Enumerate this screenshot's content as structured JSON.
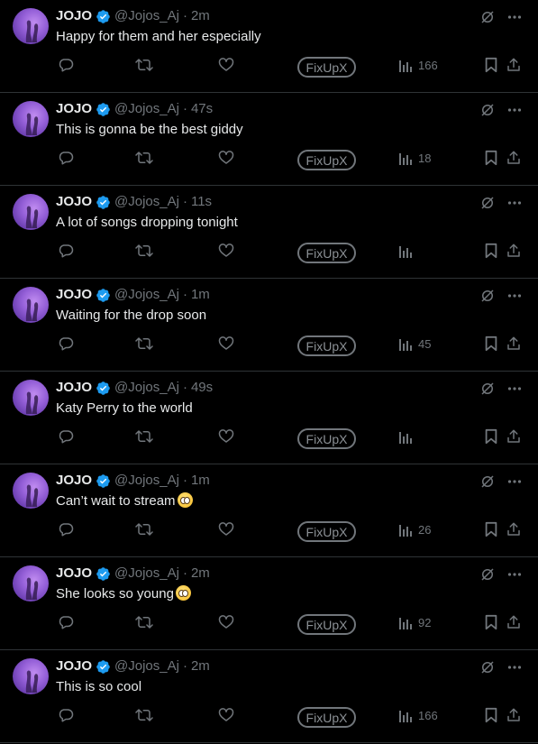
{
  "colors": {
    "background": "#000000",
    "text": "#e7e9ea",
    "muted": "#71767b",
    "verified": "#1d9bf0",
    "divider": "#2f3336"
  },
  "icons": {
    "grok": "grok-icon",
    "more": "more-icon",
    "reply": "reply-icon",
    "retweet": "retweet-icon",
    "like": "like-icon",
    "views": "views-icon",
    "bookmark": "bookmark-icon",
    "share": "share-icon"
  },
  "tweets": [
    {
      "name": "JOJO",
      "handle": "@Jojos_Aj",
      "dot": "·",
      "time": "2m",
      "text": "Happy for them and her especially",
      "fix_label": "FixUpX",
      "views": "166",
      "emoji": false
    },
    {
      "name": "JOJO",
      "handle": "@Jojos_Aj",
      "dot": "·",
      "time": "47s",
      "text": "This is gonna be the best giddy",
      "fix_label": "FixUpX",
      "views": "18",
      "emoji": false
    },
    {
      "name": "JOJO",
      "handle": "@Jojos_Aj",
      "dot": "·",
      "time": "11s",
      "text": "A lot of songs dropping tonight",
      "fix_label": "FixUpX",
      "views": "",
      "emoji": false
    },
    {
      "name": "JOJO",
      "handle": "@Jojos_Aj",
      "dot": "·",
      "time": "1m",
      "text": "Waiting for the drop soon",
      "fix_label": "FixUpX",
      "views": "45",
      "emoji": false
    },
    {
      "name": "JOJO",
      "handle": "@Jojos_Aj",
      "dot": "·",
      "time": "49s",
      "text": "Katy Perry to the world",
      "fix_label": "FixUpX",
      "views": "",
      "emoji": false
    },
    {
      "name": "JOJO",
      "handle": "@Jojos_Aj",
      "dot": "·",
      "time": "1m",
      "text": "Can’t wait to stream",
      "fix_label": "FixUpX",
      "views": "26",
      "emoji": true
    },
    {
      "name": "JOJO",
      "handle": "@Jojos_Aj",
      "dot": "·",
      "time": "2m",
      "text": "She looks so young",
      "fix_label": "FixUpX",
      "views": "92",
      "emoji": true
    },
    {
      "name": "JOJO",
      "handle": "@Jojos_Aj",
      "dot": "·",
      "time": "2m",
      "text": "This is so cool",
      "fix_label": "FixUpX",
      "views": "166",
      "emoji": false
    }
  ]
}
